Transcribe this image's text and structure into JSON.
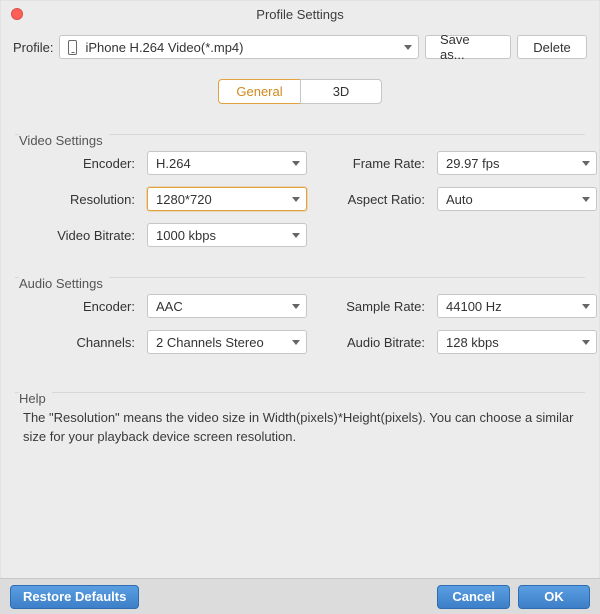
{
  "window": {
    "title": "Profile Settings"
  },
  "profile": {
    "label": "Profile:",
    "value": "iPhone H.264 Video(*.mp4)",
    "saveAs": "Save as...",
    "delete": "Delete"
  },
  "tabs": {
    "general": "General",
    "threeD": "3D"
  },
  "video": {
    "legend": "Video Settings",
    "encoderLabel": "Encoder:",
    "encoder": "H.264",
    "resolutionLabel": "Resolution:",
    "resolution": "1280*720",
    "bitrateLabel": "Video Bitrate:",
    "bitrate": "1000 kbps",
    "framerateLabel": "Frame Rate:",
    "framerate": "29.97 fps",
    "aspectLabel": "Aspect Ratio:",
    "aspect": "Auto"
  },
  "audio": {
    "legend": "Audio Settings",
    "encoderLabel": "Encoder:",
    "encoder": "AAC",
    "channelsLabel": "Channels:",
    "channels": "2 Channels Stereo",
    "samplerateLabel": "Sample Rate:",
    "samplerate": "44100 Hz",
    "bitrateLabel": "Audio Bitrate:",
    "bitrate": "128 kbps"
  },
  "help": {
    "legend": "Help",
    "text": "The \"Resolution\" means the video size in Width(pixels)*Height(pixels).  You can choose a similar size for your playback device screen resolution."
  },
  "footer": {
    "restore": "Restore Defaults",
    "cancel": "Cancel",
    "ok": "OK"
  }
}
